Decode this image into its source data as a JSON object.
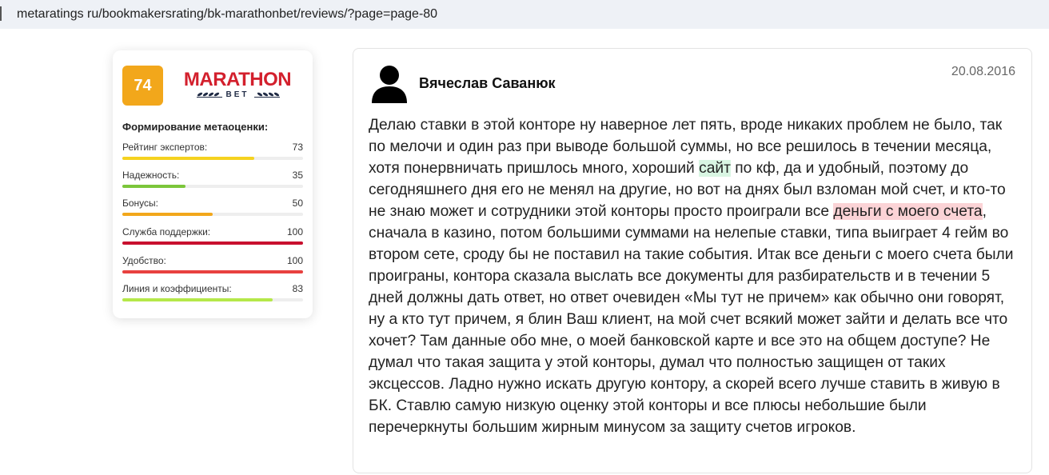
{
  "address_bar": {
    "url": "metaratings ru/bookmakersrating/bk-marathonbet/reviews/?page=page-80"
  },
  "rating_card": {
    "score": "74",
    "brand": {
      "name": "MARATHON",
      "sub": "BET"
    },
    "metrics_title": "Формирование метаоценки:",
    "metrics": [
      {
        "label": "Рейтинг экспертов:",
        "value": "73",
        "fill": 0.73,
        "color": "#f5d21f"
      },
      {
        "label": "Надежность:",
        "value": "35",
        "fill": 0.35,
        "color": "#7bc63a"
      },
      {
        "label": "Бонусы:",
        "value": "50",
        "fill": 0.5,
        "color": "#f2a71b"
      },
      {
        "label": "Служба поддержки:",
        "value": "100",
        "fill": 1.0,
        "color": "#c8102e"
      },
      {
        "label": "Удобство:",
        "value": "100",
        "fill": 1.0,
        "color": "#e8413f"
      },
      {
        "label": "Линия и коэффициенты:",
        "value": "83",
        "fill": 0.83,
        "color": "#b5e84a"
      }
    ]
  },
  "review": {
    "author": "Вячеслав Саванюк",
    "date": "20.08.2016",
    "text_part1": "Делаю ставки в этой конторе ну наверное лет пять, вроде никаких проблем не было, так по мелочи и один раз при выводе большой суммы, но все решилось в течении месяца, хотя понервничать пришлось много, хороший ",
    "highlight_green": "сайт",
    "text_part2": " по кф, да и удобный, поэтому до сегодняшнего дня его не менял на другие, но вот на днях был взломан мой счет, и кто-то не знаю может и сотрудники этой конторы просто проиграли все ",
    "highlight_red": "деньги с моего счета",
    "text_part3": ", сначала в казино, потом большими суммами на нелепые ставки, типа выиграет 4 гейм во втором сете, сроду бы не поставил на такие события. Итак все деньги с моего счета были проиграны, контора сказала выслать все документы для разбирательств и в течении 5 дней должны дать ответ, но ответ очевиден «Мы тут не причем» как обычно они говорят, ну а кто тут причем, я блин Ваш клиент, на мой счет всякий может зайти и делать все что хочет? Там данные обо мне, о моей банковской карте и все это на общем доступе? Не думал что такая защита у этой конторы, думал что полностью защищен от таких эксцессов. Ладно нужно искать другую контору, а скорей всего лучше ставить в живую в БК. Ставлю самую низкую оценку этой конторы и все плюсы небольшие были перечеркнуты большим жирным минусом за защиту счетов игроков."
  }
}
